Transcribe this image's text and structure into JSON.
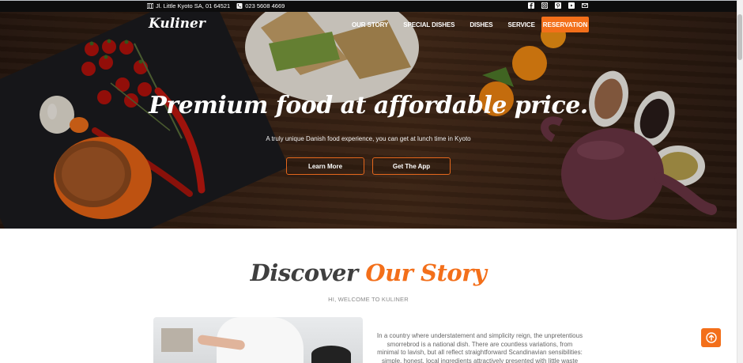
{
  "topbar": {
    "address": "Jl. Little Kyoto SA, 01 64521",
    "phone": "023 5608 4669",
    "social_icons": [
      "facebook-icon",
      "instagram-icon",
      "pinterest-icon",
      "youtube-icon",
      "mail-icon"
    ]
  },
  "header": {
    "logo": "Kuliner",
    "nav": [
      "OUR STORY",
      "SPECIAL DISHES",
      "DISHES",
      "SERVICE"
    ],
    "cta": "RESERVATION"
  },
  "hero": {
    "title": "Premium food at affordable price.",
    "subtitle": "A truly unique Danish food experience, you can get at lunch time in Kyoto",
    "btn_learn": "Learn More",
    "btn_app": "Get The App"
  },
  "story": {
    "heading_1": "Discover",
    "heading_2": "Our Story",
    "welcome": "HI, WELCOME TO KULINER",
    "text": "In a country where understatement and simplicity reign, the unpretentious smorrebrod is a national dish. There are countless variations, from minimal to lavish, but all reflect straightforward Scandinavian sensibilities: simple, honest, local ingredients attractively presented with little waste"
  },
  "colors": {
    "accent": "#f36f1a",
    "topbar": "#0d0d0d",
    "heading_dark": "#3f3f3f"
  }
}
